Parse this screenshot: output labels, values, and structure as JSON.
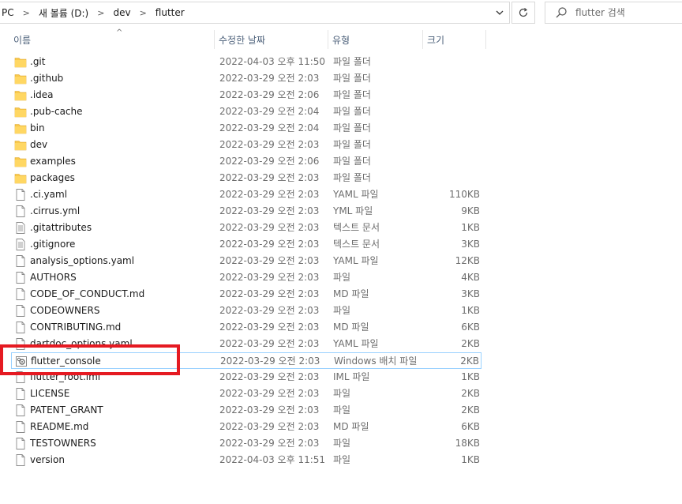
{
  "address": {
    "crumbs": [
      "PC",
      "새 볼륨 (D:)",
      "dev",
      "flutter"
    ]
  },
  "search": {
    "placeholder": "flutter 검색"
  },
  "columns": {
    "name": "이름",
    "date": "수정한 날짜",
    "type": "유형",
    "size": "크기"
  },
  "colors": {
    "folder": "#f8c84c",
    "selection_border": "#99d1ff",
    "highlight": "#e51a22",
    "header_text": "#4c607a"
  },
  "files": [
    {
      "name": ".git",
      "date": "2022-04-03 오후 11:50",
      "type": "파일 폴더",
      "size": "",
      "icon": "folder-icon"
    },
    {
      "name": ".github",
      "date": "2022-03-29 오전 2:03",
      "type": "파일 폴더",
      "size": "",
      "icon": "folder-icon"
    },
    {
      "name": ".idea",
      "date": "2022-03-29 오전 2:06",
      "type": "파일 폴더",
      "size": "",
      "icon": "folder-icon"
    },
    {
      "name": ".pub-cache",
      "date": "2022-03-29 오전 2:04",
      "type": "파일 폴더",
      "size": "",
      "icon": "folder-icon"
    },
    {
      "name": "bin",
      "date": "2022-03-29 오전 2:04",
      "type": "파일 폴더",
      "size": "",
      "icon": "folder-icon"
    },
    {
      "name": "dev",
      "date": "2022-03-29 오전 2:03",
      "type": "파일 폴더",
      "size": "",
      "icon": "folder-icon"
    },
    {
      "name": "examples",
      "date": "2022-03-29 오전 2:06",
      "type": "파일 폴더",
      "size": "",
      "icon": "folder-icon"
    },
    {
      "name": "packages",
      "date": "2022-03-29 오전 2:03",
      "type": "파일 폴더",
      "size": "",
      "icon": "folder-icon"
    },
    {
      "name": ".ci.yaml",
      "date": "2022-03-29 오전 2:03",
      "type": "YAML 파일",
      "size": "110KB",
      "icon": "file-icon"
    },
    {
      "name": ".cirrus.yml",
      "date": "2022-03-29 오전 2:03",
      "type": "YML 파일",
      "size": "9KB",
      "icon": "file-icon"
    },
    {
      "name": ".gitattributes",
      "date": "2022-03-29 오전 2:03",
      "type": "텍스트 문서",
      "size": "1KB",
      "icon": "text-file-icon"
    },
    {
      "name": ".gitignore",
      "date": "2022-03-29 오전 2:03",
      "type": "텍스트 문서",
      "size": "3KB",
      "icon": "text-file-icon"
    },
    {
      "name": "analysis_options.yaml",
      "date": "2022-03-29 오전 2:03",
      "type": "YAML 파일",
      "size": "12KB",
      "icon": "file-icon"
    },
    {
      "name": "AUTHORS",
      "date": "2022-03-29 오전 2:03",
      "type": "파일",
      "size": "4KB",
      "icon": "file-icon"
    },
    {
      "name": "CODE_OF_CONDUCT.md",
      "date": "2022-03-29 오전 2:03",
      "type": "MD 파일",
      "size": "3KB",
      "icon": "file-icon"
    },
    {
      "name": "CODEOWNERS",
      "date": "2022-03-29 오전 2:03",
      "type": "파일",
      "size": "1KB",
      "icon": "file-icon"
    },
    {
      "name": "CONTRIBUTING.md",
      "date": "2022-03-29 오전 2:03",
      "type": "MD 파일",
      "size": "6KB",
      "icon": "file-icon"
    },
    {
      "name": "dartdoc_options.yaml",
      "date": "2022-03-29 오전 2:03",
      "type": "YAML 파일",
      "size": "2KB",
      "icon": "file-icon"
    },
    {
      "name": "flutter_console",
      "date": "2022-03-29 오전 2:03",
      "type": "Windows 배치 파일",
      "size": "2KB",
      "icon": "batch-file-icon",
      "selected": true
    },
    {
      "name": "flutter_root.iml",
      "date": "2022-03-29 오전 2:03",
      "type": "IML 파일",
      "size": "1KB",
      "icon": "file-icon"
    },
    {
      "name": "LICENSE",
      "date": "2022-03-29 오전 2:03",
      "type": "파일",
      "size": "2KB",
      "icon": "file-icon"
    },
    {
      "name": "PATENT_GRANT",
      "date": "2022-03-29 오전 2:03",
      "type": "파일",
      "size": "2KB",
      "icon": "file-icon"
    },
    {
      "name": "README.md",
      "date": "2022-03-29 오전 2:03",
      "type": "MD 파일",
      "size": "6KB",
      "icon": "file-icon"
    },
    {
      "name": "TESTOWNERS",
      "date": "2022-03-29 오전 2:03",
      "type": "파일",
      "size": "18KB",
      "icon": "file-icon"
    },
    {
      "name": "version",
      "date": "2022-04-03 오후 11:51",
      "type": "파일",
      "size": "1KB",
      "icon": "file-icon"
    }
  ]
}
